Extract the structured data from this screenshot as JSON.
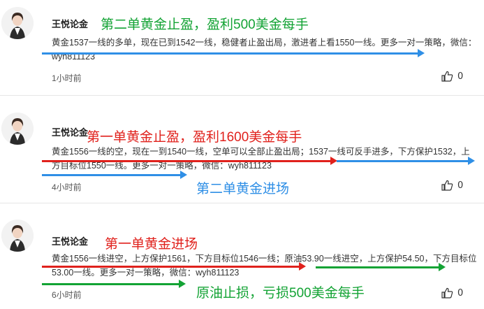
{
  "colors": {
    "green": "#13a334",
    "red": "#e0211c",
    "blue": "#2f8fe6"
  },
  "posts": [
    {
      "author": "王悦论金",
      "annotations": [
        "第二单黄金止盈，盈利500美金每手"
      ],
      "body": "黄金1537一线的多单，现在已到1542一线，稳健者止盈出局，激进者上看1550一线。更多一对一策略，微信：wyh811123",
      "time": "1小时前",
      "likes": "0"
    },
    {
      "author": "王悦论金",
      "annotations": [
        "第一单黄金止盈，盈利1600美金每手",
        "第二单黄金进场"
      ],
      "body": "黄金1556一线的空，现在一到1540一线，空单可以全部止盈出局；1537一线可反手进多，下方保护1532，上方目标位1550一线。更多一对一策略，微信：wyh811123",
      "time": "4小时前",
      "likes": "0"
    },
    {
      "author": "王悦论金",
      "annotations": [
        "第一单黄金进场",
        "原油止损，亏损500美金每手"
      ],
      "body": "黄金1556一线进空，上方保护1561，下方目标位1546一线；原油53.90一线进空，上方保护54.50，下方目标位53.00一线。更多一对一策略，微信：wyh811123",
      "time": "6小时前",
      "likes": "0"
    }
  ]
}
